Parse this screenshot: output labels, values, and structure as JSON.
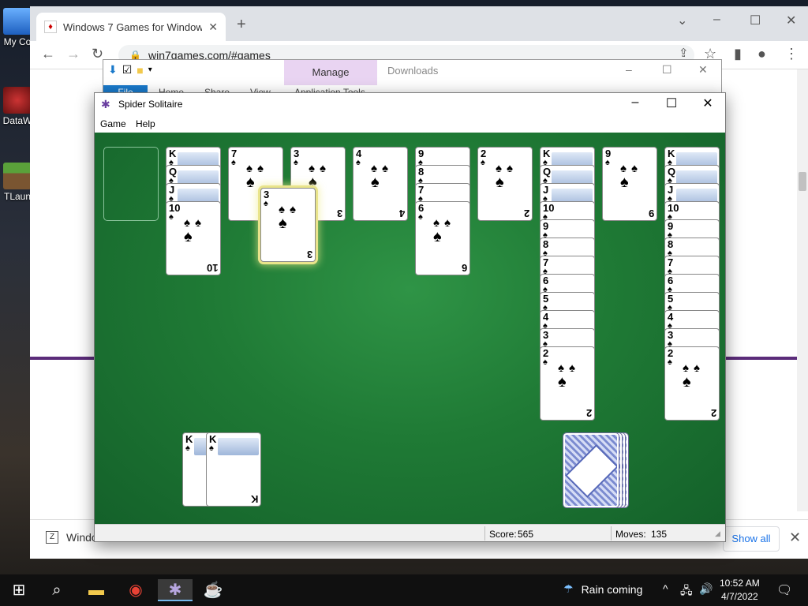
{
  "desktop": {
    "icons": [
      {
        "label": "My Co"
      },
      {
        "label": "DataW"
      },
      {
        "label": "TLaun"
      }
    ]
  },
  "browser": {
    "tab_title": "Windows 7 Games for Windows",
    "url": "win7games.com/#games",
    "download_item": "Windo",
    "show_all": "Show all"
  },
  "explorer": {
    "context_tab": "Manage",
    "title": "Downloads",
    "file_tab": "File",
    "ribbon": [
      "Home",
      "Share",
      "View",
      "Application Tools"
    ]
  },
  "spider": {
    "title": "Spider Solitaire",
    "menu": [
      "Game",
      "Help"
    ],
    "score_label": "Score:",
    "score": "565",
    "moves_label": "Moves:",
    "moves": "135",
    "suit": "♠",
    "columns": [
      [
        "K",
        "Q",
        "J",
        "10"
      ],
      [
        "7"
      ],
      [
        "3"
      ],
      [
        "4"
      ],
      [
        "9",
        "8",
        "7",
        "6"
      ],
      [
        "2"
      ],
      [
        "K",
        "Q",
        "J",
        "10",
        "9",
        "8",
        "7",
        "6",
        "5",
        "4",
        "3",
        "2"
      ],
      [
        "9"
      ],
      [
        "K",
        "Q",
        "J",
        "10",
        "9",
        "8",
        "7",
        "6",
        "5",
        "4",
        "3",
        "2"
      ]
    ],
    "dragged_card": "3",
    "foundation": [
      "K",
      "K"
    ],
    "stock_count": 4
  },
  "taskbar": {
    "weather": "Rain coming",
    "time": "10:52 AM",
    "date": "4/7/2022"
  }
}
